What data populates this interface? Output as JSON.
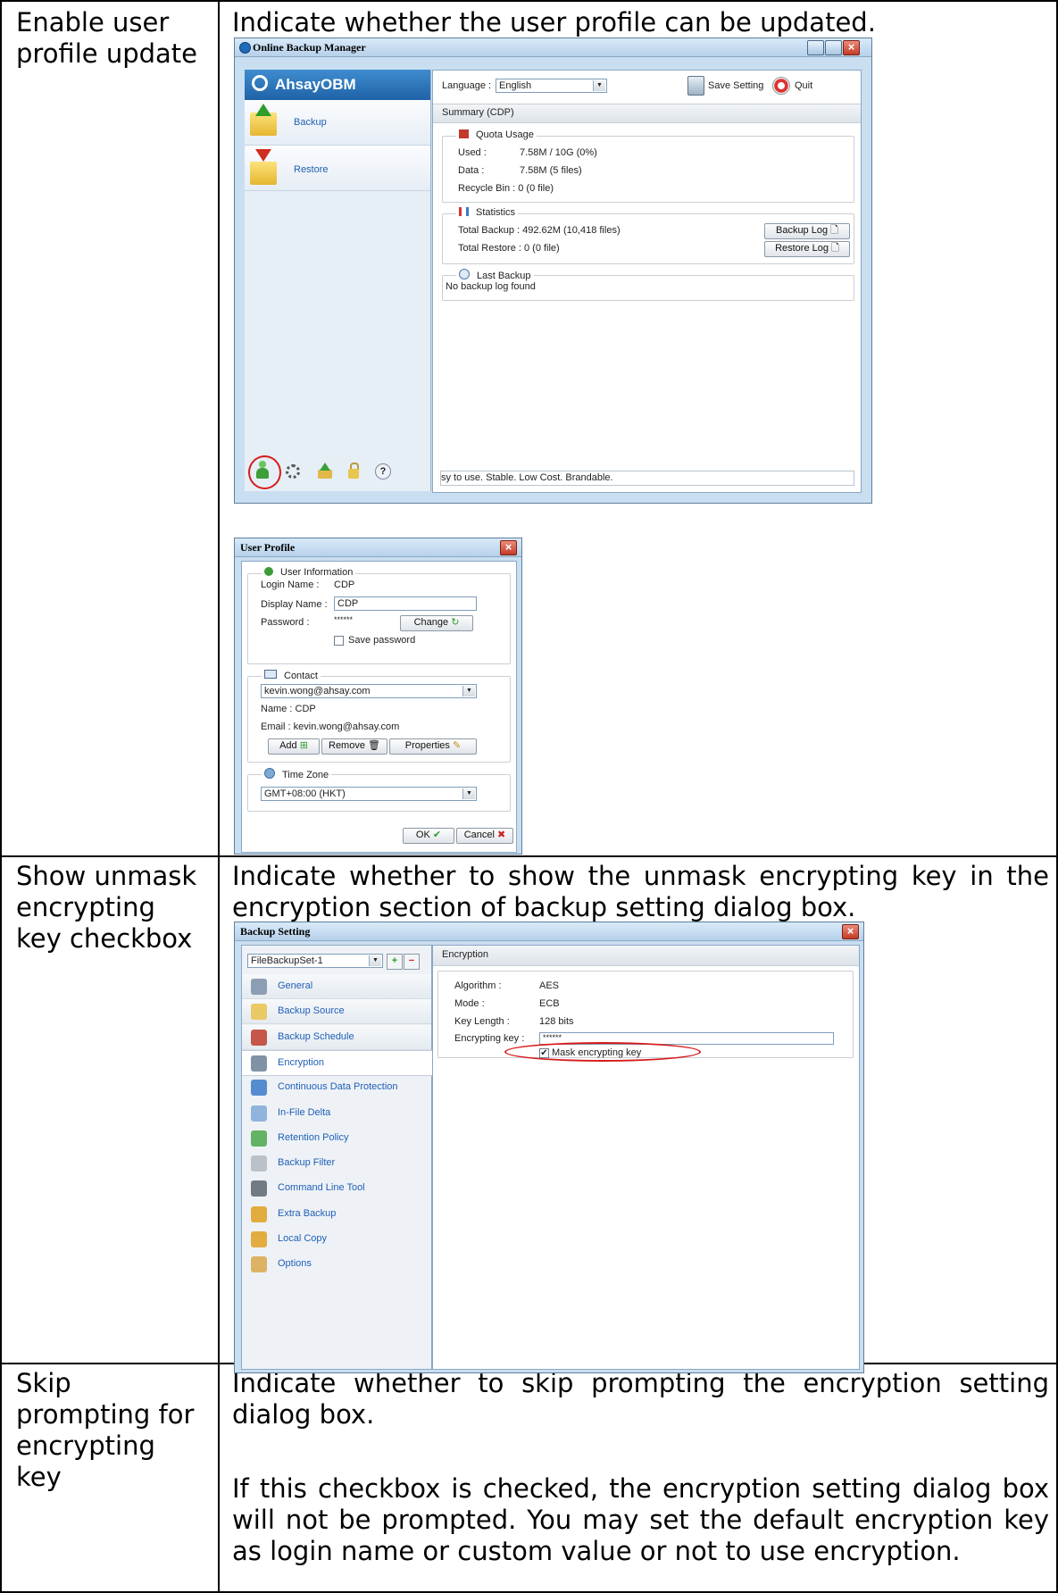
{
  "rows": [
    {
      "name": "Enable user profile update",
      "description": "Indicate whether the user profile can be updated."
    },
    {
      "name": "Show unmask encrypting key checkbox",
      "description": "Indicate whether to show the unmask encrypting key in the encryption section of backup setting dialog box."
    },
    {
      "name": "Skip prompting for encrypting key",
      "description": "Indicate whether to skip prompting the encryption setting dialog box.",
      "description2": "If this checkbox is checked, the encryption setting dialog box will not be prompted. You may set the default encryption key as login name or custom value or not to use encryption."
    }
  ],
  "obm": {
    "window_title": "Online Backup Manager",
    "brand": "AhsayOBM",
    "nav": [
      "Backup",
      "Restore"
    ],
    "language_label": "Language :",
    "language_value": "English",
    "save_setting": "Save Setting",
    "quit": "Quit",
    "summary_title": "Summary (CDP)",
    "quota_title": "Quota Usage",
    "used_label": "Used :",
    "used_value": "7.58M / 10G (0%)",
    "data_label": "Data :",
    "data_value": "7.58M  (5 files)",
    "recycle_line": "Recycle Bin :  0  (0 file)",
    "stats_title": "Statistics",
    "total_backup": "Total Backup :   492.62M  (10,418 files)",
    "total_restore": "Total Restore :  0  (0 file)",
    "backup_log": "Backup Log",
    "restore_log": "Restore Log",
    "last_backup_title": "Last Backup",
    "last_backup_value": "No backup log found",
    "status": "sy to use. Stable. Low Cost. Brandable."
  },
  "profile": {
    "title": "User Profile",
    "user_info_title": "User Information",
    "login_name_label": "Login Name :",
    "login_name_value": "CDP",
    "display_name_label": "Display Name :",
    "display_name_value": "CDP",
    "password_label": "Password :",
    "password_value": "******",
    "change_button": "Change",
    "save_password": "Save password",
    "contact_title": "Contact",
    "contact_select": "kevin.wong@ahsay.com",
    "name_line": "Name :  CDP",
    "email_line": "Email :  kevin.wong@ahsay.com",
    "add_button": "Add",
    "remove_button": "Remove",
    "properties_button": "Properties",
    "timezone_title": "Time Zone",
    "timezone_value": "GMT+08:00 (HKT)",
    "ok_button": "OK",
    "cancel_button": "Cancel"
  },
  "backup_setting": {
    "title": "Backup Setting",
    "set_select": "FileBackupSet-1",
    "nav": [
      "General",
      "Backup Source",
      "Backup Schedule",
      "Encryption",
      "Continuous Data Protection",
      "In-File Delta",
      "Retention Policy",
      "Backup Filter",
      "Command Line Tool",
      "Extra Backup",
      "Local Copy",
      "Options"
    ],
    "panel_title": "Encryption",
    "algorithm_label": "Algorithm :",
    "algorithm_value": "AES",
    "mode_label": "Mode :",
    "mode_value": "ECB",
    "key_length_label": "Key Length :",
    "key_length_value": "128 bits",
    "encrypting_key_label": "Encrypting key :",
    "encrypting_key_value": "******",
    "mask_label": "Mask encrypting key"
  }
}
